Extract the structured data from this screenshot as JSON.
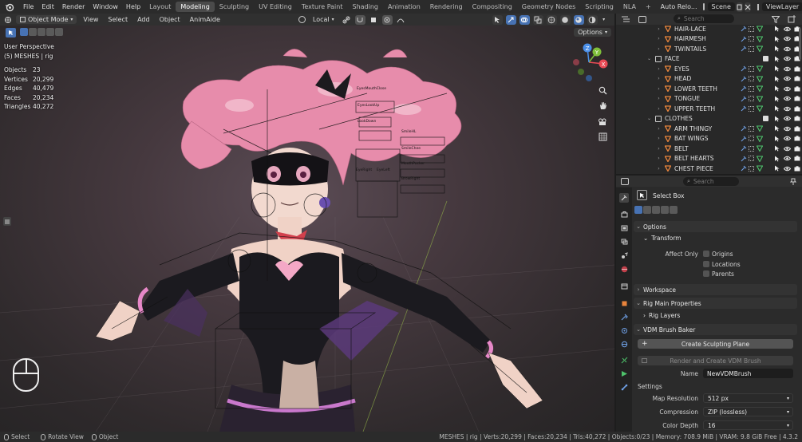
{
  "topbar": {
    "menus": [
      "File",
      "Edit",
      "Render",
      "Window",
      "Help"
    ],
    "workspaces": [
      "Layout",
      "Modeling",
      "Sculpting",
      "UV Editing",
      "Texture Paint",
      "Shading",
      "Animation",
      "Rendering",
      "Compositing",
      "Geometry Nodes",
      "Scripting",
      "NLA"
    ],
    "active_workspace": "Modeling",
    "add_tab": "+",
    "auto_reload": "Auto Relo...",
    "scene": "Scene",
    "view_layer": "ViewLayer"
  },
  "viewport_header": {
    "mode": "Object Mode",
    "menus": [
      "View",
      "Select",
      "Add",
      "Object",
      "AnimAide"
    ],
    "orientation": "Local",
    "options": "Options"
  },
  "viewport": {
    "perspective": "User Perspective",
    "collection": "(5) MESHES | rig",
    "stats": [
      {
        "label": "Objects",
        "value": "23"
      },
      {
        "label": "Vertices",
        "value": "20,299"
      },
      {
        "label": "Edges",
        "value": "40,479"
      },
      {
        "label": "Faces",
        "value": "20,234"
      },
      {
        "label": "Triangles",
        "value": "40,272"
      }
    ],
    "rig_labels": [
      "EyesMouthClose",
      "EyesLookUp",
      "LookDown",
      "SmileHL",
      "SmileChee",
      "EyeRight",
      "EyeLeft",
      "MouthPucker",
      "BrowRight"
    ],
    "gizmo": {
      "x": "X",
      "y": "Y",
      "z": "Z"
    }
  },
  "outliner": {
    "search_placeholder": "Search",
    "rows": [
      {
        "label": "HAIR-LACE",
        "indent": 2,
        "type": "mesh"
      },
      {
        "label": "HAIRMESH",
        "indent": 2,
        "type": "mesh"
      },
      {
        "label": "TWINTAILS",
        "indent": 2,
        "type": "mesh"
      },
      {
        "label": "FACE",
        "indent": 1,
        "type": "collection"
      },
      {
        "label": "EYES",
        "indent": 2,
        "type": "mesh"
      },
      {
        "label": "HEAD",
        "indent": 2,
        "type": "mesh"
      },
      {
        "label": "LOWER TEETH",
        "indent": 2,
        "type": "mesh"
      },
      {
        "label": "TONGUE",
        "indent": 2,
        "type": "mesh"
      },
      {
        "label": "UPPER TEETH",
        "indent": 2,
        "type": "mesh"
      },
      {
        "label": "CLOTHES",
        "indent": 1,
        "type": "collection"
      },
      {
        "label": "ARM THINGY",
        "indent": 2,
        "type": "mesh"
      },
      {
        "label": "BAT WINGS",
        "indent": 2,
        "type": "mesh"
      },
      {
        "label": "BELT",
        "indent": 2,
        "type": "mesh"
      },
      {
        "label": "BELT HEARTS",
        "indent": 2,
        "type": "mesh"
      },
      {
        "label": "CHEST PIECE",
        "indent": 2,
        "type": "mesh"
      }
    ]
  },
  "properties": {
    "search_placeholder": "Search",
    "tool_name": "Select Box",
    "options_panel": "Options",
    "transform_panel": "Transform",
    "affect_only_label": "Affect Only",
    "affect_only": [
      "Origins",
      "Locations",
      "Parents"
    ],
    "workspace_panel": "Workspace",
    "rig_main_panel": "Rig Main Properties",
    "rig_layers_panel": "Rig Layers",
    "vdm_panel": "VDM Brush Baker",
    "create_plane_btn": "Create Sculpting Plane",
    "render_btn": "Render and Create VDM Brush",
    "name_label": "Name",
    "name_value": "NewVDMBrush",
    "settings_label": "Settings",
    "map_res_label": "Map Resolution",
    "map_res_value": "512 px",
    "compression_label": "Compression",
    "compression_value": "ZIP (lossless)",
    "color_depth_label": "Color Depth",
    "color_depth_value": "16"
  },
  "statusbar": {
    "select": "Select",
    "rotate": "Rotate View",
    "object": "Object",
    "right": "MESHES | rig | Verts:20,299 | Faces:20,234 | Tris:40,272 | Objects:0/23 | Memory: 708.9 MiB | VRAM: 9.8 GiB Free | 4.3.2"
  },
  "colors": {
    "accent": "#4772b3",
    "orange_mesh": "#e8843c",
    "filter_green": "#4ec26b",
    "hair_pink": "#e78cab",
    "axis_x": "#e94a55",
    "axis_y": "#7fbf3a",
    "axis_z": "#4a8ee8"
  }
}
